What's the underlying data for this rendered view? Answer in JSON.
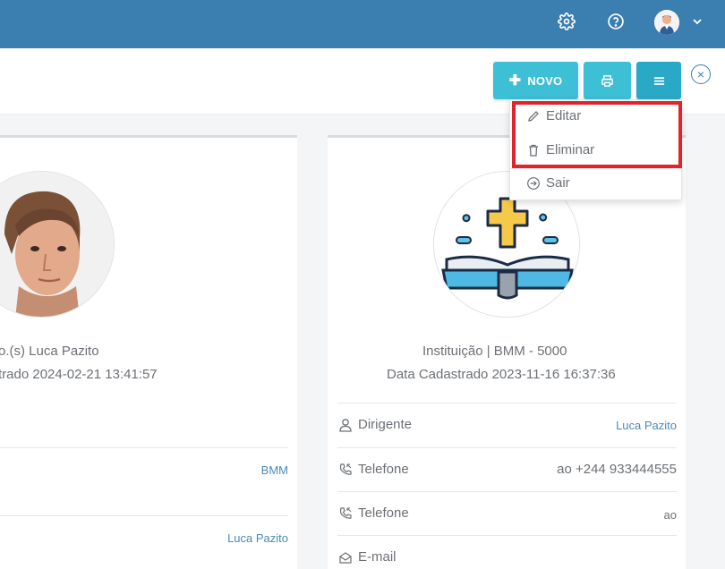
{
  "header": {
    "icons": [
      "gear-icon",
      "help-icon",
      "user-avatar",
      "chevron-down-icon"
    ]
  },
  "toolbar": {
    "novo_label": "NOVO",
    "print_icon": "printer-icon",
    "menu_icon": "hamburger-icon",
    "close_icon": "close-circle-icon"
  },
  "dropdown": {
    "items": [
      {
        "label": "Editar",
        "icon": "pencil-icon"
      },
      {
        "label": "Eliminar",
        "icon": "trash-icon"
      },
      {
        "label": "Sair",
        "icon": "exit-icon"
      }
    ]
  },
  "cards": [
    {
      "title": "o.(s) Luca Pazito",
      "subtitle": "trado 2024-02-21 13:41:57",
      "rows": [
        {
          "label": "",
          "value": "BMM"
        },
        {
          "label": "",
          "value": "Luca Pazito"
        }
      ]
    },
    {
      "title": "Instituição | BMM - 5000",
      "subtitle": "Data Cadastrado 2023-11-16 16:37:36",
      "rows": [
        {
          "label": "Dirigente",
          "value": "Luca Pazito",
          "icon": "user-icon"
        },
        {
          "label": "Telefone",
          "value": "ao +244 933444555",
          "icon": "phone-icon"
        },
        {
          "label": "Telefone",
          "value": "ao",
          "icon": "phone-icon"
        },
        {
          "label": "E-mail",
          "value": "",
          "icon": "mail-icon"
        }
      ]
    }
  ],
  "colors": {
    "topbar": "#3a7fb0",
    "button": "#3dbfd6",
    "highlight": "#e0242c",
    "link": "#4a8ab8"
  }
}
